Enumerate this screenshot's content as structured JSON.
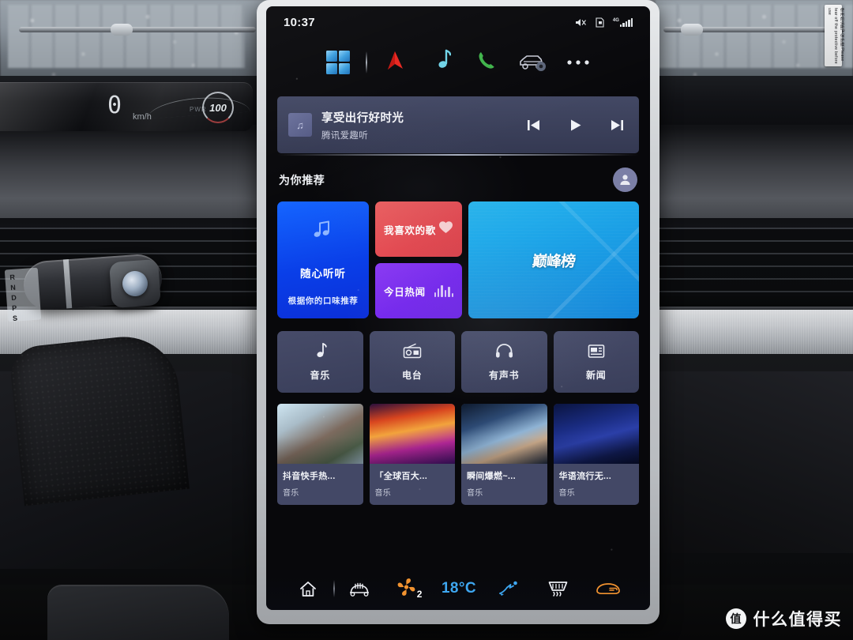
{
  "statusbar": {
    "clock": "10:37",
    "icons": [
      "mute-icon",
      "sim-card-icon",
      "signal-4g-icon"
    ],
    "network": "4G"
  },
  "dock": {
    "items": [
      {
        "name": "apps-grid-icon",
        "label": "应用"
      },
      {
        "name": "navigation-icon",
        "label": "导航"
      },
      {
        "name": "music-note-icon",
        "label": "音乐"
      },
      {
        "name": "phone-icon",
        "label": "电话"
      },
      {
        "name": "car-settings-icon",
        "label": "车辆设置"
      },
      {
        "name": "more-icon",
        "label": "更多"
      }
    ]
  },
  "now_playing": {
    "title": "享受出行好时光",
    "subtitle": "腾讯爱趣听",
    "art_icon": "music-note-icon",
    "controls": [
      "prev",
      "play",
      "next"
    ]
  },
  "recommend": {
    "section_title": "为你推荐",
    "avatar_icon": "user-avatar-icon",
    "tiles": [
      {
        "id": "suixin",
        "title": "随心听听",
        "subtitle": "根据你的口味推荐",
        "color": "#0a3fe8",
        "icon": "double-music-note-icon"
      },
      {
        "id": "favorite",
        "title": "我喜欢的歌",
        "color": "#e24a52",
        "icon": "heart-icon"
      },
      {
        "id": "hotnews",
        "title": "今日热闻",
        "color": "#7526ef",
        "icon": "waveform-icon"
      },
      {
        "id": "rank",
        "title": "巅峰榜",
        "color": "#1ba0e6",
        "icon": "crown-icon"
      }
    ]
  },
  "categories": [
    {
      "label": "音乐",
      "icon": "music-note-icon"
    },
    {
      "label": "电台",
      "icon": "radio-icon"
    },
    {
      "label": "有声书",
      "icon": "headphones-icon"
    },
    {
      "label": "新闻",
      "icon": "news-icon"
    }
  ],
  "playlist_cards": [
    {
      "title": "抖音快手热...",
      "subtitle": "音乐"
    },
    {
      "title": "「全球百大...",
      "subtitle": "音乐"
    },
    {
      "title": "瞬间爆燃~...",
      "subtitle": "音乐"
    },
    {
      "title": "华语流行无...",
      "subtitle": "音乐"
    }
  ],
  "climate": {
    "home_icon": "home-icon",
    "seat_icon": "seat-heat-icon",
    "fan_icon": "fan-icon",
    "fan_level": "2",
    "temperature": "18°C",
    "airflow_icon": "airflow-icon",
    "defrost_icon": "rear-defrost-icon",
    "windshield_icon": "windshield-defrost-icon",
    "accent_fan": "#f29330",
    "accent_temp": "#3ea7f0"
  },
  "cluster": {
    "speed": "0",
    "unit": "km/h",
    "power_label": "PWR",
    "gauge": "100"
  },
  "gear_selector": {
    "labels": "R\nN\nD\nP\nS"
  },
  "sticker": {
    "text": "使用前请撕下保护膜 Please tear off the protective before use"
  },
  "watermark": {
    "logo": "值",
    "text": "什么值得买"
  }
}
